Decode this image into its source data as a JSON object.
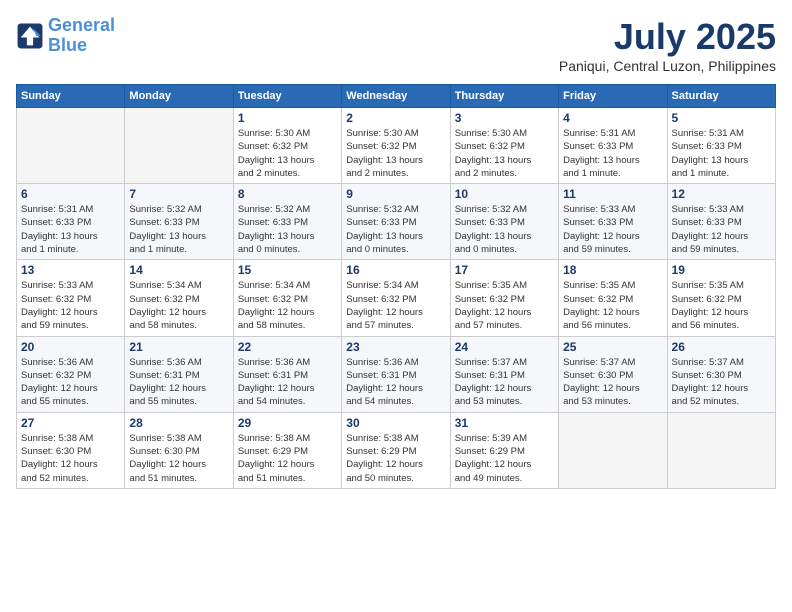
{
  "header": {
    "logo_line1": "General",
    "logo_line2": "Blue",
    "month": "July 2025",
    "location": "Paniqui, Central Luzon, Philippines"
  },
  "weekdays": [
    "Sunday",
    "Monday",
    "Tuesday",
    "Wednesday",
    "Thursday",
    "Friday",
    "Saturday"
  ],
  "weeks": [
    [
      {
        "day": "",
        "info": ""
      },
      {
        "day": "",
        "info": ""
      },
      {
        "day": "1",
        "info": "Sunrise: 5:30 AM\nSunset: 6:32 PM\nDaylight: 13 hours\nand 2 minutes."
      },
      {
        "day": "2",
        "info": "Sunrise: 5:30 AM\nSunset: 6:32 PM\nDaylight: 13 hours\nand 2 minutes."
      },
      {
        "day": "3",
        "info": "Sunrise: 5:30 AM\nSunset: 6:32 PM\nDaylight: 13 hours\nand 2 minutes."
      },
      {
        "day": "4",
        "info": "Sunrise: 5:31 AM\nSunset: 6:33 PM\nDaylight: 13 hours\nand 1 minute."
      },
      {
        "day": "5",
        "info": "Sunrise: 5:31 AM\nSunset: 6:33 PM\nDaylight: 13 hours\nand 1 minute."
      }
    ],
    [
      {
        "day": "6",
        "info": "Sunrise: 5:31 AM\nSunset: 6:33 PM\nDaylight: 13 hours\nand 1 minute."
      },
      {
        "day": "7",
        "info": "Sunrise: 5:32 AM\nSunset: 6:33 PM\nDaylight: 13 hours\nand 1 minute."
      },
      {
        "day": "8",
        "info": "Sunrise: 5:32 AM\nSunset: 6:33 PM\nDaylight: 13 hours\nand 0 minutes."
      },
      {
        "day": "9",
        "info": "Sunrise: 5:32 AM\nSunset: 6:33 PM\nDaylight: 13 hours\nand 0 minutes."
      },
      {
        "day": "10",
        "info": "Sunrise: 5:32 AM\nSunset: 6:33 PM\nDaylight: 13 hours\nand 0 minutes."
      },
      {
        "day": "11",
        "info": "Sunrise: 5:33 AM\nSunset: 6:33 PM\nDaylight: 12 hours\nand 59 minutes."
      },
      {
        "day": "12",
        "info": "Sunrise: 5:33 AM\nSunset: 6:33 PM\nDaylight: 12 hours\nand 59 minutes."
      }
    ],
    [
      {
        "day": "13",
        "info": "Sunrise: 5:33 AM\nSunset: 6:32 PM\nDaylight: 12 hours\nand 59 minutes."
      },
      {
        "day": "14",
        "info": "Sunrise: 5:34 AM\nSunset: 6:32 PM\nDaylight: 12 hours\nand 58 minutes."
      },
      {
        "day": "15",
        "info": "Sunrise: 5:34 AM\nSunset: 6:32 PM\nDaylight: 12 hours\nand 58 minutes."
      },
      {
        "day": "16",
        "info": "Sunrise: 5:34 AM\nSunset: 6:32 PM\nDaylight: 12 hours\nand 57 minutes."
      },
      {
        "day": "17",
        "info": "Sunrise: 5:35 AM\nSunset: 6:32 PM\nDaylight: 12 hours\nand 57 minutes."
      },
      {
        "day": "18",
        "info": "Sunrise: 5:35 AM\nSunset: 6:32 PM\nDaylight: 12 hours\nand 56 minutes."
      },
      {
        "day": "19",
        "info": "Sunrise: 5:35 AM\nSunset: 6:32 PM\nDaylight: 12 hours\nand 56 minutes."
      }
    ],
    [
      {
        "day": "20",
        "info": "Sunrise: 5:36 AM\nSunset: 6:32 PM\nDaylight: 12 hours\nand 55 minutes."
      },
      {
        "day": "21",
        "info": "Sunrise: 5:36 AM\nSunset: 6:31 PM\nDaylight: 12 hours\nand 55 minutes."
      },
      {
        "day": "22",
        "info": "Sunrise: 5:36 AM\nSunset: 6:31 PM\nDaylight: 12 hours\nand 54 minutes."
      },
      {
        "day": "23",
        "info": "Sunrise: 5:36 AM\nSunset: 6:31 PM\nDaylight: 12 hours\nand 54 minutes."
      },
      {
        "day": "24",
        "info": "Sunrise: 5:37 AM\nSunset: 6:31 PM\nDaylight: 12 hours\nand 53 minutes."
      },
      {
        "day": "25",
        "info": "Sunrise: 5:37 AM\nSunset: 6:30 PM\nDaylight: 12 hours\nand 53 minutes."
      },
      {
        "day": "26",
        "info": "Sunrise: 5:37 AM\nSunset: 6:30 PM\nDaylight: 12 hours\nand 52 minutes."
      }
    ],
    [
      {
        "day": "27",
        "info": "Sunrise: 5:38 AM\nSunset: 6:30 PM\nDaylight: 12 hours\nand 52 minutes."
      },
      {
        "day": "28",
        "info": "Sunrise: 5:38 AM\nSunset: 6:30 PM\nDaylight: 12 hours\nand 51 minutes."
      },
      {
        "day": "29",
        "info": "Sunrise: 5:38 AM\nSunset: 6:29 PM\nDaylight: 12 hours\nand 51 minutes."
      },
      {
        "day": "30",
        "info": "Sunrise: 5:38 AM\nSunset: 6:29 PM\nDaylight: 12 hours\nand 50 minutes."
      },
      {
        "day": "31",
        "info": "Sunrise: 5:39 AM\nSunset: 6:29 PM\nDaylight: 12 hours\nand 49 minutes."
      },
      {
        "day": "",
        "info": ""
      },
      {
        "day": "",
        "info": ""
      }
    ]
  ]
}
